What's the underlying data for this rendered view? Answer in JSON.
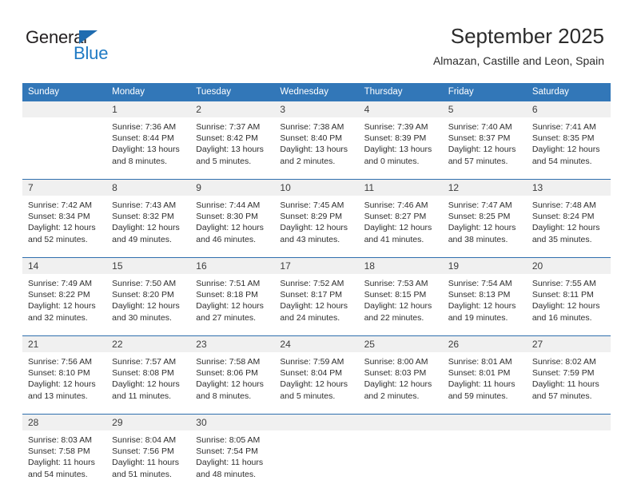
{
  "brand": {
    "name_part1": "General",
    "name_part2": "Blue",
    "accent_color": "#1f7ac4",
    "triangle_color": "#1f6cb0"
  },
  "header": {
    "title": "September 2025",
    "subtitle": "Almazan, Castille and Leon, Spain"
  },
  "calendar": {
    "header_bg": "#3277b8",
    "daynum_bg": "#f0f0f0",
    "rule_color": "#2f6fae",
    "weekdays": [
      "Sunday",
      "Monday",
      "Tuesday",
      "Wednesday",
      "Thursday",
      "Friday",
      "Saturday"
    ],
    "weeks": [
      [
        {
          "day": "",
          "sunrise": "",
          "sunset": "",
          "daylight": ""
        },
        {
          "day": "1",
          "sunrise": "Sunrise: 7:36 AM",
          "sunset": "Sunset: 8:44 PM",
          "daylight": "Daylight: 13 hours and 8 minutes."
        },
        {
          "day": "2",
          "sunrise": "Sunrise: 7:37 AM",
          "sunset": "Sunset: 8:42 PM",
          "daylight": "Daylight: 13 hours and 5 minutes."
        },
        {
          "day": "3",
          "sunrise": "Sunrise: 7:38 AM",
          "sunset": "Sunset: 8:40 PM",
          "daylight": "Daylight: 13 hours and 2 minutes."
        },
        {
          "day": "4",
          "sunrise": "Sunrise: 7:39 AM",
          "sunset": "Sunset: 8:39 PM",
          "daylight": "Daylight: 13 hours and 0 minutes."
        },
        {
          "day": "5",
          "sunrise": "Sunrise: 7:40 AM",
          "sunset": "Sunset: 8:37 PM",
          "daylight": "Daylight: 12 hours and 57 minutes."
        },
        {
          "day": "6",
          "sunrise": "Sunrise: 7:41 AM",
          "sunset": "Sunset: 8:35 PM",
          "daylight": "Daylight: 12 hours and 54 minutes."
        }
      ],
      [
        {
          "day": "7",
          "sunrise": "Sunrise: 7:42 AM",
          "sunset": "Sunset: 8:34 PM",
          "daylight": "Daylight: 12 hours and 52 minutes."
        },
        {
          "day": "8",
          "sunrise": "Sunrise: 7:43 AM",
          "sunset": "Sunset: 8:32 PM",
          "daylight": "Daylight: 12 hours and 49 minutes."
        },
        {
          "day": "9",
          "sunrise": "Sunrise: 7:44 AM",
          "sunset": "Sunset: 8:30 PM",
          "daylight": "Daylight: 12 hours and 46 minutes."
        },
        {
          "day": "10",
          "sunrise": "Sunrise: 7:45 AM",
          "sunset": "Sunset: 8:29 PM",
          "daylight": "Daylight: 12 hours and 43 minutes."
        },
        {
          "day": "11",
          "sunrise": "Sunrise: 7:46 AM",
          "sunset": "Sunset: 8:27 PM",
          "daylight": "Daylight: 12 hours and 41 minutes."
        },
        {
          "day": "12",
          "sunrise": "Sunrise: 7:47 AM",
          "sunset": "Sunset: 8:25 PM",
          "daylight": "Daylight: 12 hours and 38 minutes."
        },
        {
          "day": "13",
          "sunrise": "Sunrise: 7:48 AM",
          "sunset": "Sunset: 8:24 PM",
          "daylight": "Daylight: 12 hours and 35 minutes."
        }
      ],
      [
        {
          "day": "14",
          "sunrise": "Sunrise: 7:49 AM",
          "sunset": "Sunset: 8:22 PM",
          "daylight": "Daylight: 12 hours and 32 minutes."
        },
        {
          "day": "15",
          "sunrise": "Sunrise: 7:50 AM",
          "sunset": "Sunset: 8:20 PM",
          "daylight": "Daylight: 12 hours and 30 minutes."
        },
        {
          "day": "16",
          "sunrise": "Sunrise: 7:51 AM",
          "sunset": "Sunset: 8:18 PM",
          "daylight": "Daylight: 12 hours and 27 minutes."
        },
        {
          "day": "17",
          "sunrise": "Sunrise: 7:52 AM",
          "sunset": "Sunset: 8:17 PM",
          "daylight": "Daylight: 12 hours and 24 minutes."
        },
        {
          "day": "18",
          "sunrise": "Sunrise: 7:53 AM",
          "sunset": "Sunset: 8:15 PM",
          "daylight": "Daylight: 12 hours and 22 minutes."
        },
        {
          "day": "19",
          "sunrise": "Sunrise: 7:54 AM",
          "sunset": "Sunset: 8:13 PM",
          "daylight": "Daylight: 12 hours and 19 minutes."
        },
        {
          "day": "20",
          "sunrise": "Sunrise: 7:55 AM",
          "sunset": "Sunset: 8:11 PM",
          "daylight": "Daylight: 12 hours and 16 minutes."
        }
      ],
      [
        {
          "day": "21",
          "sunrise": "Sunrise: 7:56 AM",
          "sunset": "Sunset: 8:10 PM",
          "daylight": "Daylight: 12 hours and 13 minutes."
        },
        {
          "day": "22",
          "sunrise": "Sunrise: 7:57 AM",
          "sunset": "Sunset: 8:08 PM",
          "daylight": "Daylight: 12 hours and 11 minutes."
        },
        {
          "day": "23",
          "sunrise": "Sunrise: 7:58 AM",
          "sunset": "Sunset: 8:06 PM",
          "daylight": "Daylight: 12 hours and 8 minutes."
        },
        {
          "day": "24",
          "sunrise": "Sunrise: 7:59 AM",
          "sunset": "Sunset: 8:04 PM",
          "daylight": "Daylight: 12 hours and 5 minutes."
        },
        {
          "day": "25",
          "sunrise": "Sunrise: 8:00 AM",
          "sunset": "Sunset: 8:03 PM",
          "daylight": "Daylight: 12 hours and 2 minutes."
        },
        {
          "day": "26",
          "sunrise": "Sunrise: 8:01 AM",
          "sunset": "Sunset: 8:01 PM",
          "daylight": "Daylight: 11 hours and 59 minutes."
        },
        {
          "day": "27",
          "sunrise": "Sunrise: 8:02 AM",
          "sunset": "Sunset: 7:59 PM",
          "daylight": "Daylight: 11 hours and 57 minutes."
        }
      ],
      [
        {
          "day": "28",
          "sunrise": "Sunrise: 8:03 AM",
          "sunset": "Sunset: 7:58 PM",
          "daylight": "Daylight: 11 hours and 54 minutes."
        },
        {
          "day": "29",
          "sunrise": "Sunrise: 8:04 AM",
          "sunset": "Sunset: 7:56 PM",
          "daylight": "Daylight: 11 hours and 51 minutes."
        },
        {
          "day": "30",
          "sunrise": "Sunrise: 8:05 AM",
          "sunset": "Sunset: 7:54 PM",
          "daylight": "Daylight: 11 hours and 48 minutes."
        },
        {
          "day": "",
          "sunrise": "",
          "sunset": "",
          "daylight": ""
        },
        {
          "day": "",
          "sunrise": "",
          "sunset": "",
          "daylight": ""
        },
        {
          "day": "",
          "sunrise": "",
          "sunset": "",
          "daylight": ""
        },
        {
          "day": "",
          "sunrise": "",
          "sunset": "",
          "daylight": ""
        }
      ]
    ]
  }
}
